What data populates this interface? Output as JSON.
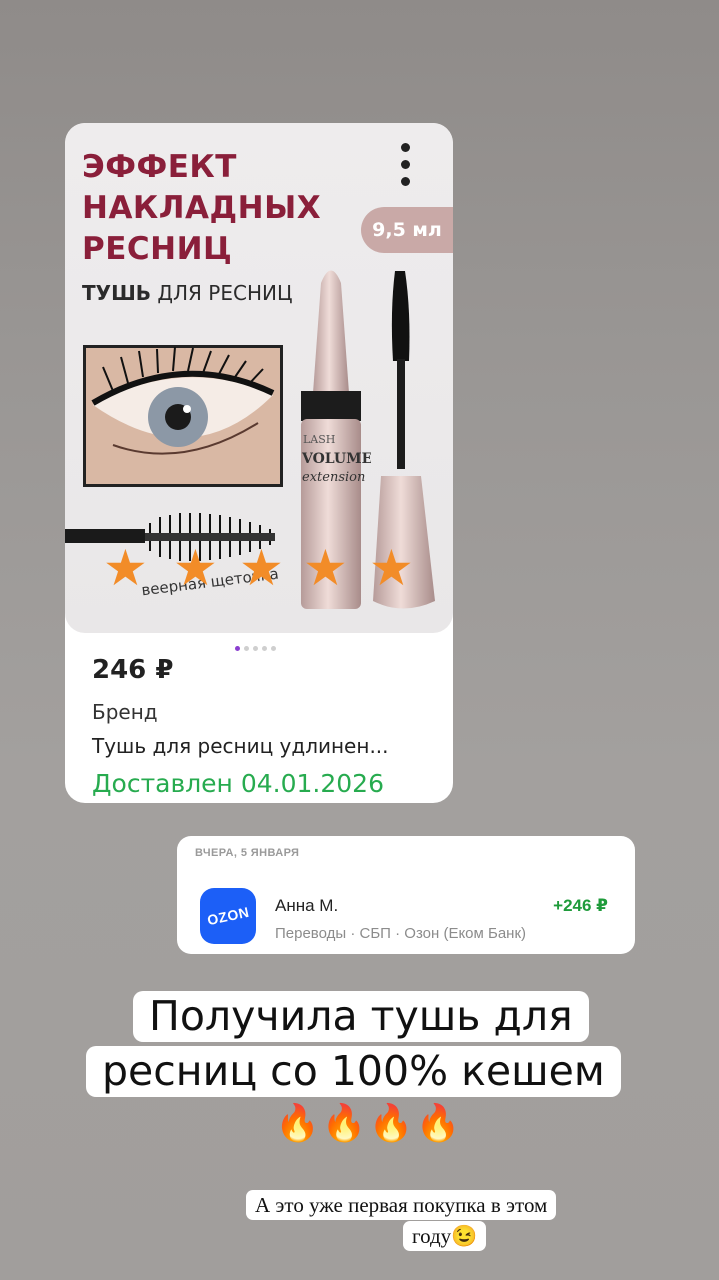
{
  "product_card": {
    "promo_title": "ЭФФЕКТ\nНАКЛАДНЫХ\nРЕСНИЦ",
    "promo_subtitle_bold": "ТУШЬ",
    "promo_subtitle_rest": " ДЛЯ РЕСНИЦ",
    "volume_badge": "9,5 мл",
    "tube_label": "LASH VOLUME extension",
    "brush_caption": "веерная щеточка",
    "rating": {
      "value": 5,
      "max": 5,
      "star_color": "#f28c28"
    },
    "carousel": {
      "total": 5,
      "active_index": 0,
      "active_color": "#8b3fd0"
    },
    "price": "246 ₽",
    "brand": "Бренд",
    "name": "Тушь для ресниц удлинен...",
    "delivery_status": "Доставлен 04.01.2026",
    "delivery_color": "#27ab4f",
    "menu_icon": "more-vertical-icon"
  },
  "transaction": {
    "date_header": "ВЧЕРА, 5 ЯНВАРЯ",
    "logo_text": "OZON",
    "logo_color": "#1c5ff7",
    "sender": "Анна М.",
    "amount": "+246 ₽",
    "amount_color": "#1f9b3b",
    "details": "Переводы · СБП · Озон (Еком Банк)"
  },
  "caption": {
    "line1": "Получила тушь для",
    "line2": "ресниц со 100% кешем",
    "emojis": [
      "🔥",
      "🔥",
      "🔥",
      "🔥"
    ]
  },
  "note": {
    "line1": "А это уже первая покупка в этом",
    "line2": "году😉"
  }
}
